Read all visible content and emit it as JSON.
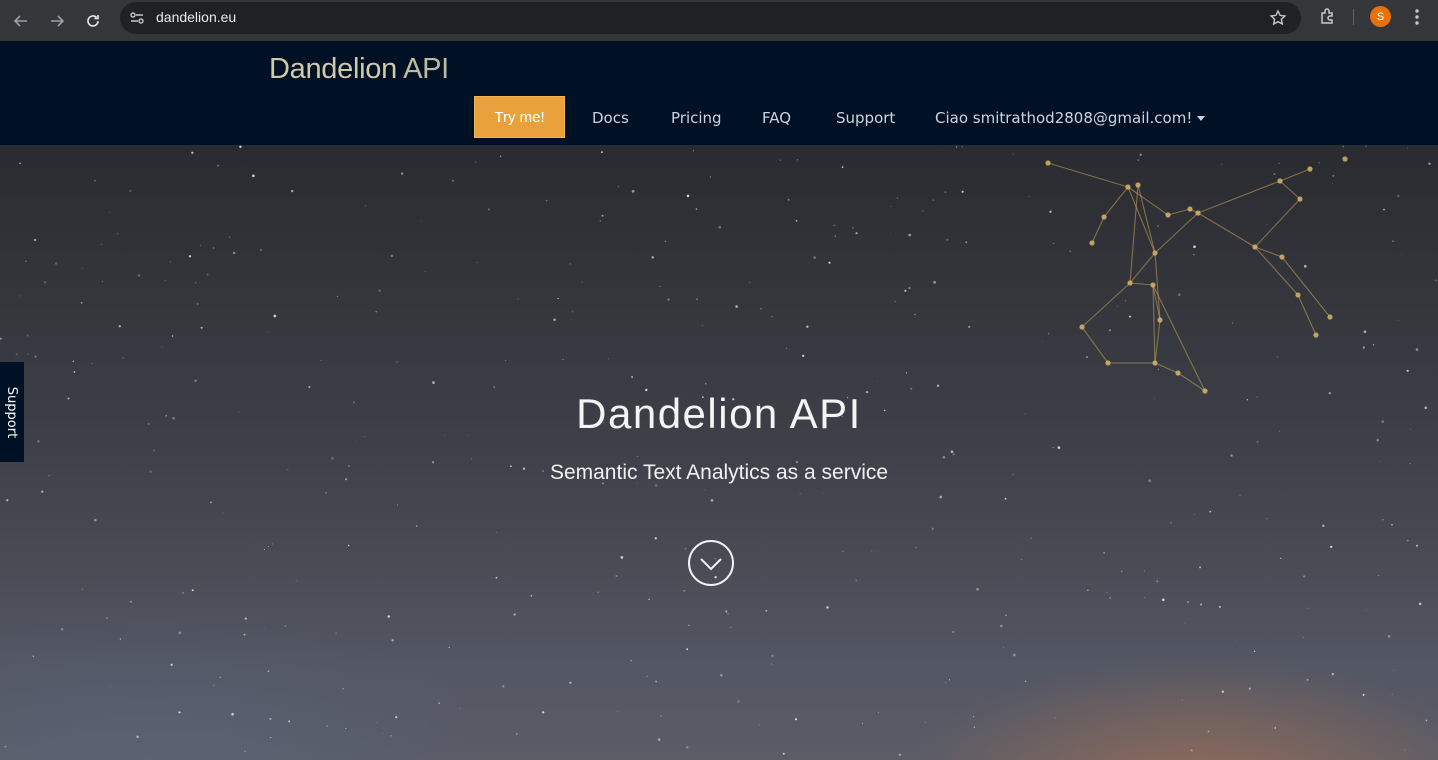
{
  "browser": {
    "url": "dandelion.eu",
    "profile_initial": "S",
    "icons": [
      "back-icon",
      "forward-icon",
      "reload-icon",
      "site-info-icon",
      "star-icon",
      "extensions-icon",
      "kebab-menu-icon"
    ]
  },
  "header": {
    "brand_part1": "Dandelion",
    "brand_part2": " API",
    "try_button": "Try me!",
    "nav": {
      "docs": "Docs",
      "pricing": "Pricing",
      "faq": "FAQ",
      "support": "Support",
      "user": "Ciao smitrathod2808@gmail.com!"
    }
  },
  "hero": {
    "title": "Dandelion API",
    "subtitle": "Semantic Text Analytics as a service"
  },
  "side_tab": {
    "label": "Support"
  },
  "colors": {
    "header_bg": "#001126",
    "accent": "#e9a23b",
    "brand_text": "#cfcaa8"
  }
}
